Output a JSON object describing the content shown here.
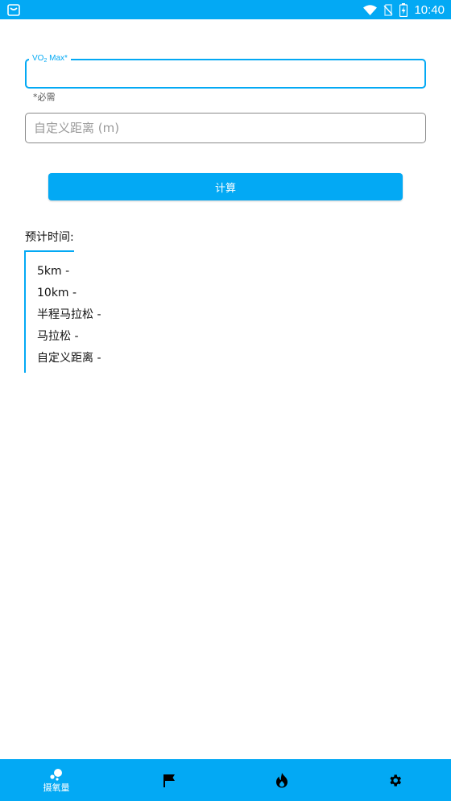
{
  "status_bar": {
    "time": "10:40",
    "left_icon": "shopping-bag-icon",
    "icons": [
      "wifi-icon",
      "no-sim-icon",
      "battery-charging-icon"
    ]
  },
  "form": {
    "vo2_label_main": "VO",
    "vo2_label_sub": "2",
    "vo2_label_rest": " Max*",
    "vo2_value": "",
    "vo2_helper": "*必需",
    "custom_distance_placeholder": "自定义距离 (m)",
    "custom_distance_value": "",
    "calculate_label": "计算"
  },
  "estimates": {
    "title": "预计时间:",
    "items": [
      "5km -",
      "10km -",
      "半程马拉松 -",
      "马拉松 -",
      "自定义距离 -"
    ]
  },
  "bottom_nav": {
    "items": [
      {
        "icon": "bubbles-icon",
        "label": "摄氧量"
      },
      {
        "icon": "flag-icon",
        "label": ""
      },
      {
        "icon": "flame-icon",
        "label": ""
      },
      {
        "icon": "gear-icon",
        "label": ""
      }
    ]
  },
  "colors": {
    "accent": "#03a9f4",
    "text": "#111111",
    "placeholder": "#9a9a9a"
  }
}
